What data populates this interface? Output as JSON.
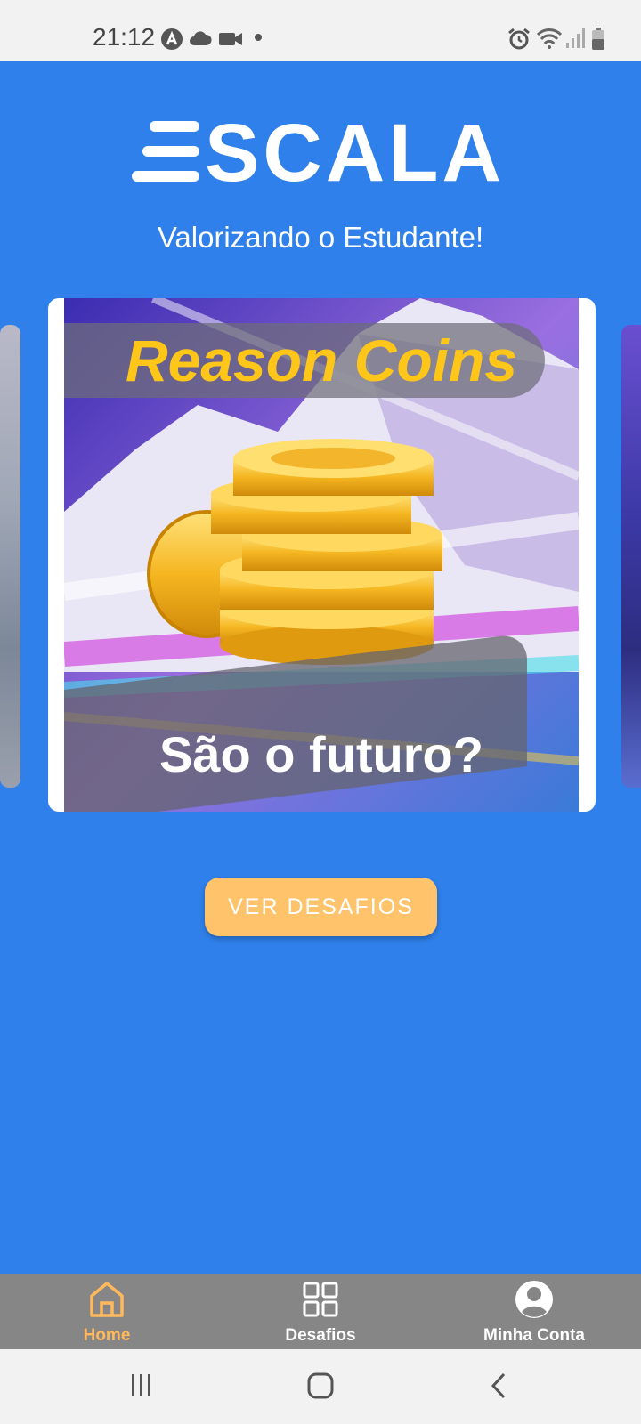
{
  "status_bar": {
    "time": "21:12",
    "left_icons": [
      "app-notification-icon",
      "cloud-icon",
      "video-camera-icon",
      "dot-icon"
    ],
    "right_icons": [
      "alarm-icon",
      "wifi-icon",
      "signal-icon",
      "battery-icon"
    ]
  },
  "header": {
    "logo_text": "SCALA",
    "tagline": "Valorizando o Estudante!"
  },
  "carousel": {
    "active_card": {
      "title": "Reason Coins",
      "subtitle": "São o futuro?"
    }
  },
  "cta": {
    "label": "VER DESAFIOS"
  },
  "bottom_nav": {
    "items": [
      {
        "label": "Home",
        "icon": "home-icon",
        "active": true
      },
      {
        "label": "Desafios",
        "icon": "grid-icon",
        "active": false
      },
      {
        "label": "Minha Conta",
        "icon": "account-icon",
        "active": false
      }
    ]
  },
  "system_nav": {
    "buttons": [
      "recent-apps-icon",
      "home-button-icon",
      "back-icon"
    ]
  },
  "colors": {
    "background": "#2f80ea",
    "accent": "#ffc36b",
    "active_nav": "#ffb85c",
    "nav_bar": "#868686",
    "title_gold": "#ffc61a"
  }
}
